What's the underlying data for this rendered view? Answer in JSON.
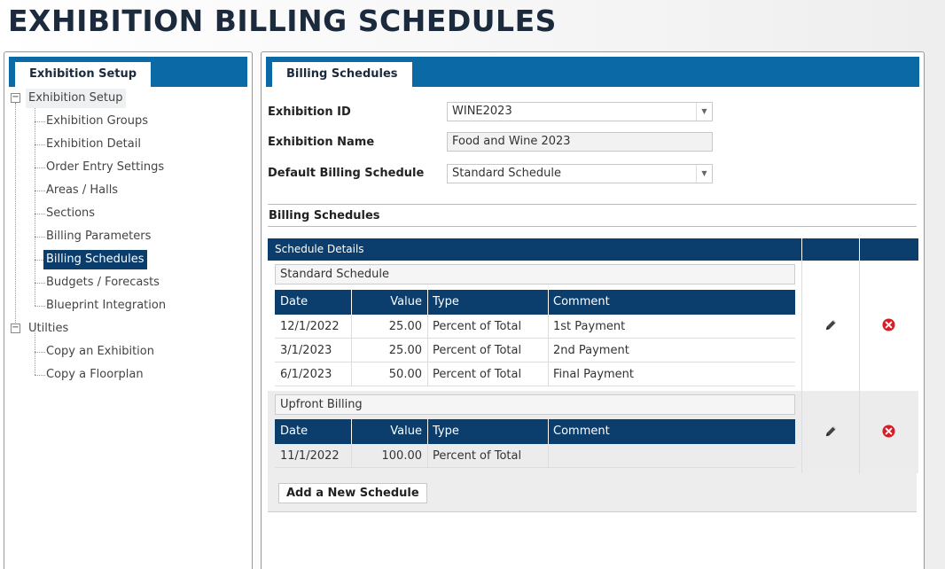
{
  "page_title": "EXHIBITION BILLING SCHEDULES",
  "left_panel": {
    "tab_label": "Exhibition Setup",
    "tree": [
      {
        "label": "Exhibition Setup",
        "level": 0,
        "expander": "−"
      },
      {
        "label": "Exhibition Groups",
        "level": 1
      },
      {
        "label": "Exhibition Detail",
        "level": 1
      },
      {
        "label": "Order Entry Settings",
        "level": 1
      },
      {
        "label": "Areas / Halls",
        "level": 1
      },
      {
        "label": "Sections",
        "level": 1
      },
      {
        "label": "Billing Parameters",
        "level": 1
      },
      {
        "label": "Billing Schedules",
        "level": 1,
        "selected": true
      },
      {
        "label": "Budgets / Forecasts",
        "level": 1
      },
      {
        "label": "Blueprint Integration",
        "level": 1
      },
      {
        "label": "Utilties",
        "level": 0,
        "expander": "−"
      },
      {
        "label": "Copy an Exhibition",
        "level": 1
      },
      {
        "label": "Copy a Floorplan",
        "level": 1
      }
    ]
  },
  "right_panel": {
    "tab_label": "Billing Schedules",
    "fields": {
      "exhibition_id": {
        "label": "Exhibition ID",
        "value": "WINE2023"
      },
      "exhibition_name": {
        "label": "Exhibition Name",
        "value": "Food and Wine 2023"
      },
      "default_schedule": {
        "label": "Default Billing Schedule",
        "value": "Standard Schedule"
      }
    },
    "section_title": "Billing Schedules",
    "grid": {
      "header": "Schedule Details",
      "columns": [
        "Date",
        "Value",
        "Type",
        "Comment"
      ],
      "schedules": [
        {
          "name": "Standard Schedule",
          "rows": [
            {
              "date": "12/1/2022",
              "value": "25.00",
              "type": "Percent of Total",
              "comment": "1st Payment"
            },
            {
              "date": "3/1/2023",
              "value": "25.00",
              "type": "Percent of Total",
              "comment": "2nd Payment"
            },
            {
              "date": "6/1/2023",
              "value": "50.00",
              "type": "Percent of Total",
              "comment": "Final Payment"
            }
          ]
        },
        {
          "name": "Upfront Billing",
          "rows": [
            {
              "date": "11/1/2022",
              "value": "100.00",
              "type": "Percent of Total",
              "comment": ""
            }
          ]
        }
      ]
    },
    "add_button_label": "Add a New Schedule"
  },
  "colors": {
    "tab_bar": "#0b6aa5",
    "header_navy": "#0b3e6d",
    "delete_red": "#d0202a"
  },
  "icons": {
    "edit": "pencil-icon",
    "delete": "delete-circle-icon"
  }
}
